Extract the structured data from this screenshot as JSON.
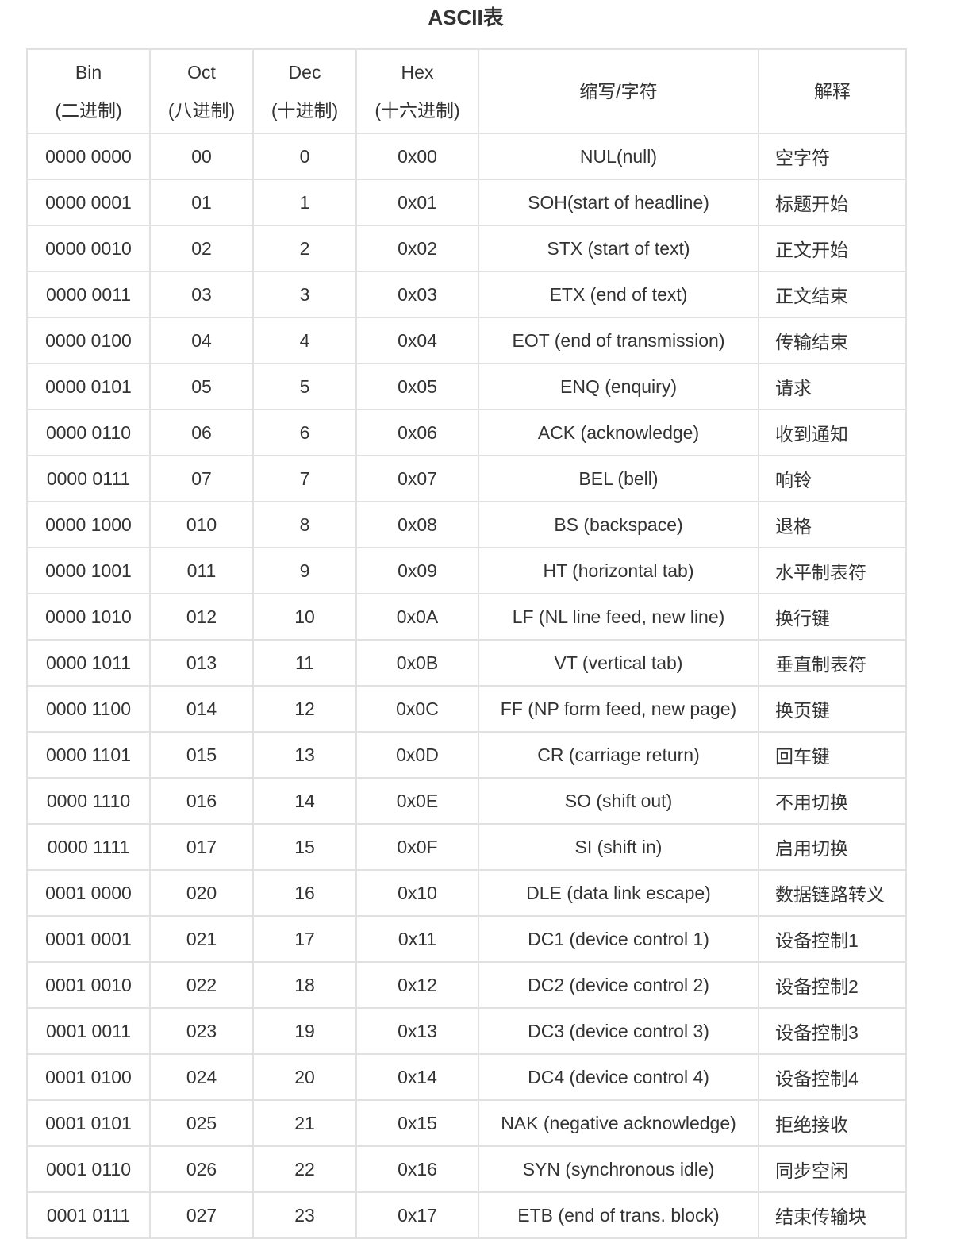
{
  "title": "ASCII表",
  "headers": {
    "bin": {
      "line1": "Bin",
      "line2": "(二进制)"
    },
    "oct": {
      "line1": "Oct",
      "line2": "(八进制)"
    },
    "dec": {
      "line1": "Dec",
      "line2": "(十进制)"
    },
    "hex": {
      "line1": "Hex",
      "line2": "(十六进制)"
    },
    "abbr": "缩写/字符",
    "desc": "解释"
  },
  "rows": [
    {
      "bin": "0000 0000",
      "oct": "00",
      "dec": "0",
      "hex": "0x00",
      "abbr": "NUL(null)",
      "desc": "空字符"
    },
    {
      "bin": "0000 0001",
      "oct": "01",
      "dec": "1",
      "hex": "0x01",
      "abbr": "SOH(start of headline)",
      "desc": "标题开始"
    },
    {
      "bin": "0000 0010",
      "oct": "02",
      "dec": "2",
      "hex": "0x02",
      "abbr": "STX (start of text)",
      "desc": "正文开始"
    },
    {
      "bin": "0000 0011",
      "oct": "03",
      "dec": "3",
      "hex": "0x03",
      "abbr": "ETX (end of text)",
      "desc": "正文结束"
    },
    {
      "bin": "0000 0100",
      "oct": "04",
      "dec": "4",
      "hex": "0x04",
      "abbr": "EOT (end of transmission)",
      "desc": "传输结束"
    },
    {
      "bin": "0000 0101",
      "oct": "05",
      "dec": "5",
      "hex": "0x05",
      "abbr": "ENQ (enquiry)",
      "desc": "请求"
    },
    {
      "bin": "0000 0110",
      "oct": "06",
      "dec": "6",
      "hex": "0x06",
      "abbr": "ACK (acknowledge)",
      "desc": "收到通知"
    },
    {
      "bin": "0000 0111",
      "oct": "07",
      "dec": "7",
      "hex": "0x07",
      "abbr": "BEL (bell)",
      "desc": "响铃"
    },
    {
      "bin": "0000 1000",
      "oct": "010",
      "dec": "8",
      "hex": "0x08",
      "abbr": "BS (backspace)",
      "desc": "退格"
    },
    {
      "bin": "0000 1001",
      "oct": "011",
      "dec": "9",
      "hex": "0x09",
      "abbr": "HT (horizontal tab)",
      "desc": "水平制表符"
    },
    {
      "bin": "0000 1010",
      "oct": "012",
      "dec": "10",
      "hex": "0x0A",
      "abbr": "LF (NL line feed, new line)",
      "desc": "换行键"
    },
    {
      "bin": "0000 1011",
      "oct": "013",
      "dec": "11",
      "hex": "0x0B",
      "abbr": "VT (vertical tab)",
      "desc": "垂直制表符"
    },
    {
      "bin": "0000 1100",
      "oct": "014",
      "dec": "12",
      "hex": "0x0C",
      "abbr": "FF (NP form feed, new page)",
      "desc": "换页键"
    },
    {
      "bin": "0000 1101",
      "oct": "015",
      "dec": "13",
      "hex": "0x0D",
      "abbr": "CR (carriage return)",
      "desc": "回车键"
    },
    {
      "bin": "0000 1110",
      "oct": "016",
      "dec": "14",
      "hex": "0x0E",
      "abbr": "SO (shift out)",
      "desc": "不用切换"
    },
    {
      "bin": "0000 1111",
      "oct": "017",
      "dec": "15",
      "hex": "0x0F",
      "abbr": "SI (shift in)",
      "desc": "启用切换"
    },
    {
      "bin": "0001 0000",
      "oct": "020",
      "dec": "16",
      "hex": "0x10",
      "abbr": "DLE (data link escape)",
      "desc": "数据链路转义"
    },
    {
      "bin": "0001 0001",
      "oct": "021",
      "dec": "17",
      "hex": "0x11",
      "abbr": "DC1 (device control 1)",
      "desc": "设备控制1"
    },
    {
      "bin": "0001 0010",
      "oct": "022",
      "dec": "18",
      "hex": "0x12",
      "abbr": "DC2 (device control 2)",
      "desc": "设备控制2"
    },
    {
      "bin": "0001 0011",
      "oct": "023",
      "dec": "19",
      "hex": "0x13",
      "abbr": "DC3 (device control 3)",
      "desc": "设备控制3"
    },
    {
      "bin": "0001 0100",
      "oct": "024",
      "dec": "20",
      "hex": "0x14",
      "abbr": "DC4 (device control 4)",
      "desc": "设备控制4"
    },
    {
      "bin": "0001 0101",
      "oct": "025",
      "dec": "21",
      "hex": "0x15",
      "abbr": "NAK (negative acknowledge)",
      "desc": "拒绝接收"
    },
    {
      "bin": "0001 0110",
      "oct": "026",
      "dec": "22",
      "hex": "0x16",
      "abbr": "SYN (synchronous idle)",
      "desc": "同步空闲"
    },
    {
      "bin": "0001 0111",
      "oct": "027",
      "dec": "23",
      "hex": "0x17",
      "abbr": "ETB (end of trans. block)",
      "desc": "结束传输块"
    }
  ]
}
